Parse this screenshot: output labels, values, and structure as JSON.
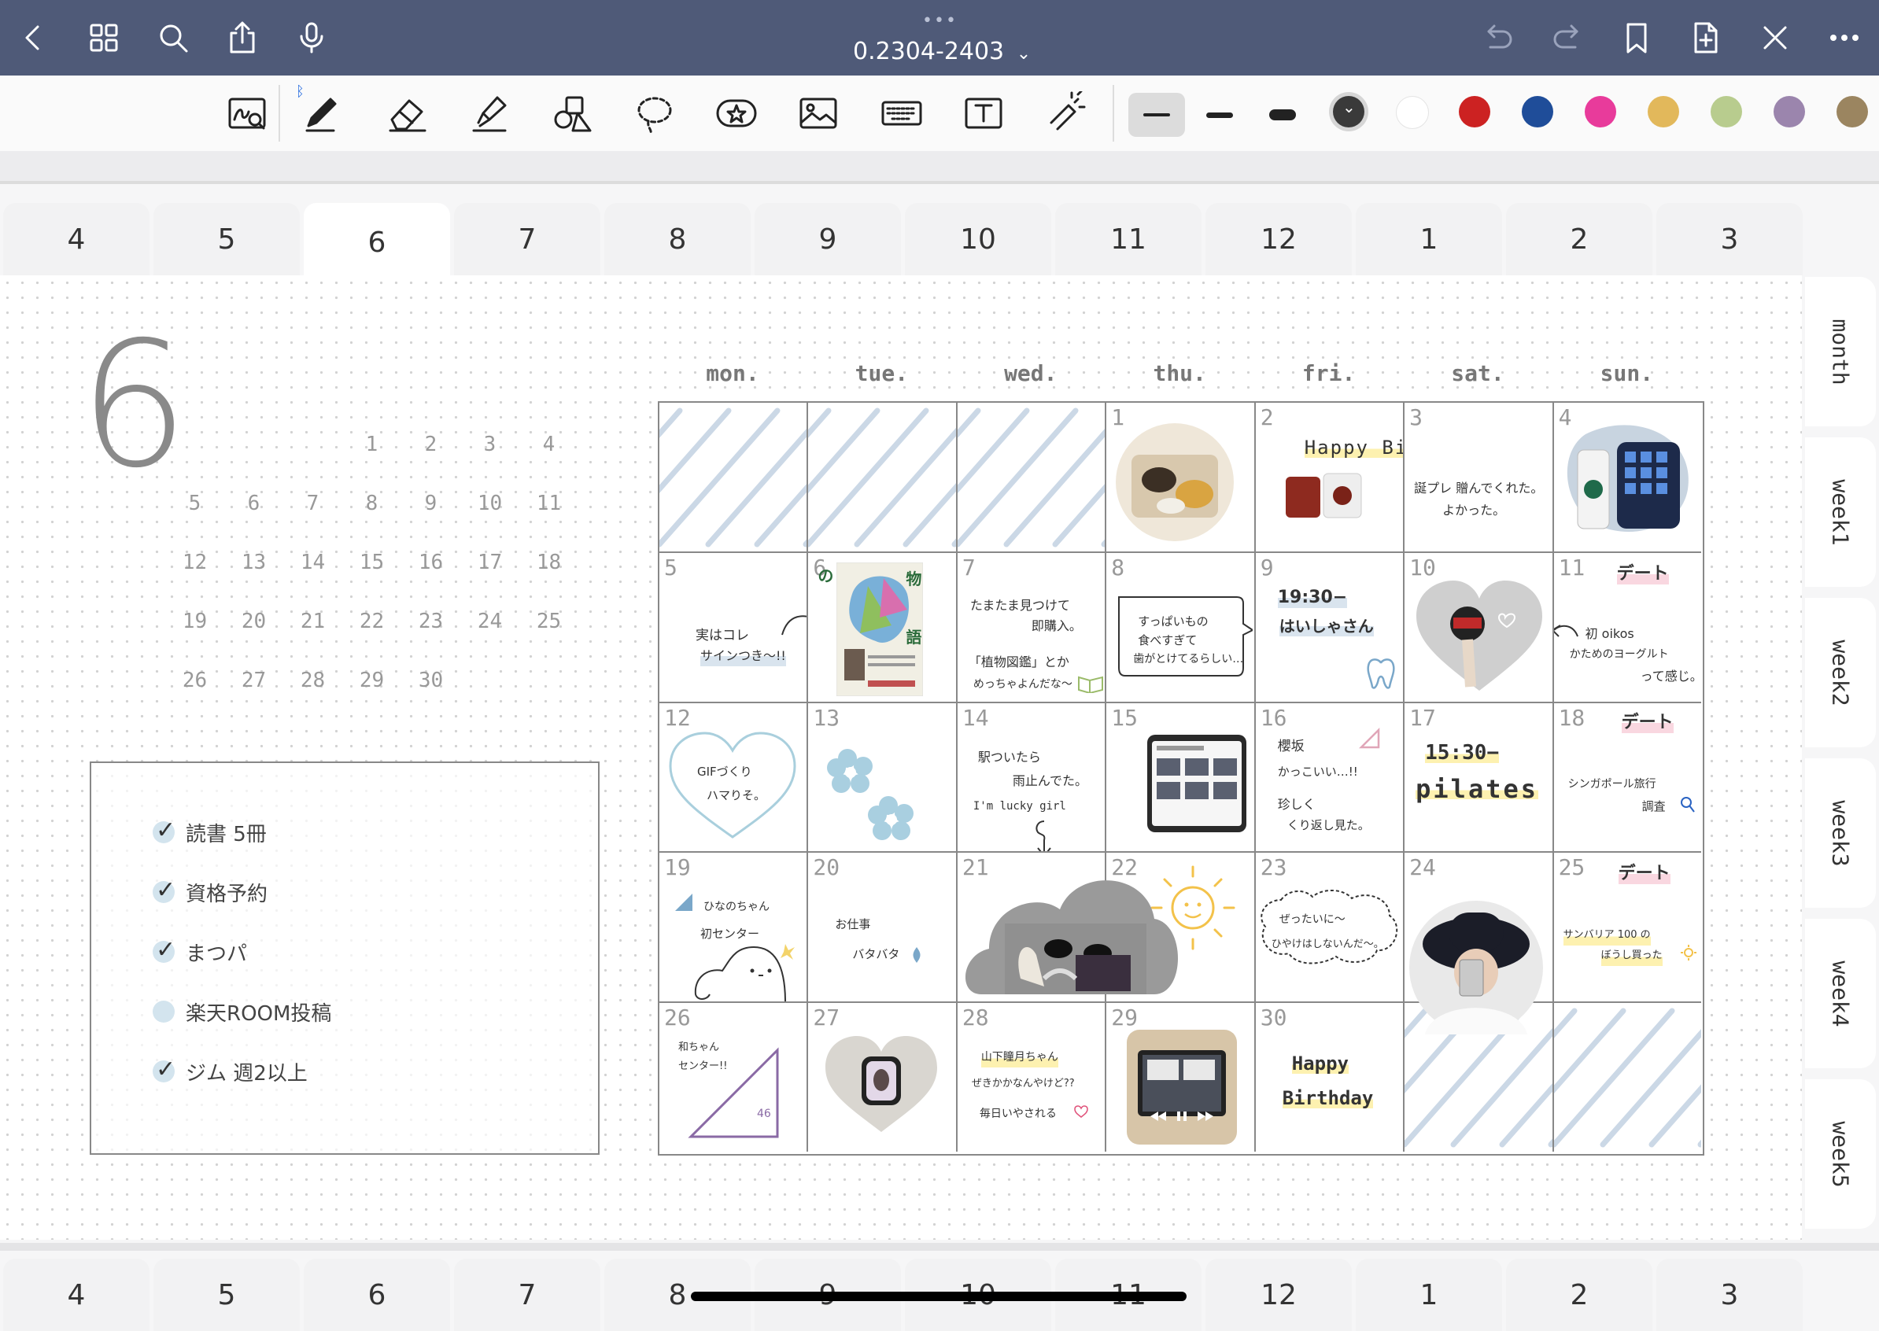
{
  "topbar": {
    "title": "0.2304-2403",
    "chevron": "⌄",
    "icons": [
      "back-icon",
      "grid-icon",
      "search-icon",
      "share-icon",
      "mic-icon",
      "undo-icon",
      "redo-icon",
      "bookmark-icon",
      "add-page-icon",
      "close-tools-icon",
      "more-icon"
    ]
  },
  "toolbar": {
    "tools": [
      "handwriting-select-icon",
      "pen-icon",
      "eraser-icon",
      "highlighter-icon",
      "shapes-icon",
      "lasso-icon",
      "sticker-icon",
      "image-icon",
      "keyboard-icon",
      "text-icon",
      "laser-icon"
    ],
    "colors": [
      "#3a3a3a",
      "#ffffff",
      "#cc2222",
      "#1f4d99",
      "#e83b9b",
      "#e2b85b",
      "#b8cc8e",
      "#9b85ad",
      "#9b8560"
    ]
  },
  "month_tabs": [
    "4",
    "5",
    "6",
    "7",
    "8",
    "9",
    "10",
    "11",
    "12",
    "1",
    "2",
    "3"
  ],
  "active_month_tab": "6",
  "side_tabs": [
    "month",
    "week1",
    "week2",
    "week3",
    "week4",
    "week5"
  ],
  "month_number": "6",
  "mini_calendar": [
    [
      "",
      "",
      "",
      "1",
      "2",
      "3",
      "4"
    ],
    [
      "5",
      "6",
      "7",
      "8",
      "9",
      "10",
      "11"
    ],
    [
      "12",
      "13",
      "14",
      "15",
      "16",
      "17",
      "18"
    ],
    [
      "19",
      "20",
      "21",
      "22",
      "23",
      "24",
      "25"
    ],
    [
      "26",
      "27",
      "28",
      "29",
      "30",
      "",
      ""
    ]
  ],
  "todos": [
    {
      "text": "読書 5冊",
      "done": true
    },
    {
      "text": "資格予約",
      "done": true
    },
    {
      "text": "まつパ",
      "done": true
    },
    {
      "text": "楽天ROOM投稿",
      "done": false
    },
    {
      "text": "ジム 週2以上",
      "done": true
    }
  ],
  "weekdays": [
    "mon.",
    "tue.",
    "wed.",
    "thu.",
    "fri.",
    "sat.",
    "sun."
  ],
  "days": {
    "d1": "1",
    "d2": "2",
    "d3": "3",
    "d4": "4",
    "d5": "5",
    "d6": "6",
    "d7": "7",
    "d8": "8",
    "d9": "9",
    "d10": "10",
    "d11": "11",
    "d12": "12",
    "d13": "13",
    "d14": "14",
    "d15": "15",
    "d16": "16",
    "d17": "17",
    "d18": "18",
    "d19": "19",
    "d20": "20",
    "d21": "21",
    "d22": "22",
    "d23": "23",
    "d24": "24",
    "d25": "25",
    "d26": "26",
    "d27": "27",
    "d28": "28",
    "d29": "29",
    "d30": "30"
  },
  "notes": {
    "d2": "Happy Birthday",
    "d3_1": "誕プレ 贈んでくれた。",
    "d3_2": "よかった。",
    "d5_1": "実はコレ",
    "d5_2": "サインつき〜!!",
    "d6_1": "の",
    "d6_2": "物",
    "d6_3": "語",
    "d7_1": "たまたま見つけて",
    "d7_2": "即購入。",
    "d7_3": "「植物図鑑」とか",
    "d7_4": "めっちゃよんだな〜",
    "d8_1": "すっぱいもの",
    "d8_2": "食べすぎて",
    "d8_3": "歯がとけてるらしい…",
    "d9_1": "19:30−",
    "d9_2": "はいしゃさん",
    "d11_1": "デート",
    "d11_2": "初 oikos",
    "d11_3": "かためのヨーグルト",
    "d11_4": "って感じ。",
    "d12_1": "GIFづくり",
    "d12_2": "ハマりそ。",
    "d14_1": "駅ついたら",
    "d14_2": "雨止んでた。",
    "d14_3": "I'm lucky girl",
    "d16_1": "櫻坂",
    "d16_2": "かっこいい…!!",
    "d16_3": "珍しく",
    "d16_4": "くり返し見た。",
    "d17_1": "15:30−",
    "d17_2": "pilates",
    "d18_1": "デート",
    "d18_2": "シンガポール旅行",
    "d18_3": "調査",
    "d19_1": "ひなのちゃん",
    "d19_2": "初センター",
    "d20_1": "お仕事",
    "d20_2": "バタバタ",
    "d23_1": "ぜったいに〜",
    "d23_2": "ひやけはしないんだ〜。",
    "d25_1": "デート",
    "d25_2": "サンバリア 100 の",
    "d25_3": "ぼうし買った",
    "d26_1": "和ちゃん",
    "d26_2": "センター!!",
    "d26_3": "46",
    "d28_1": "山下瞳月ちゃん",
    "d28_2": "ぜきかかなんやけど??",
    "d28_3": "毎日いやされる",
    "d30_1": "Happy",
    "d30_2": "Birthday"
  }
}
